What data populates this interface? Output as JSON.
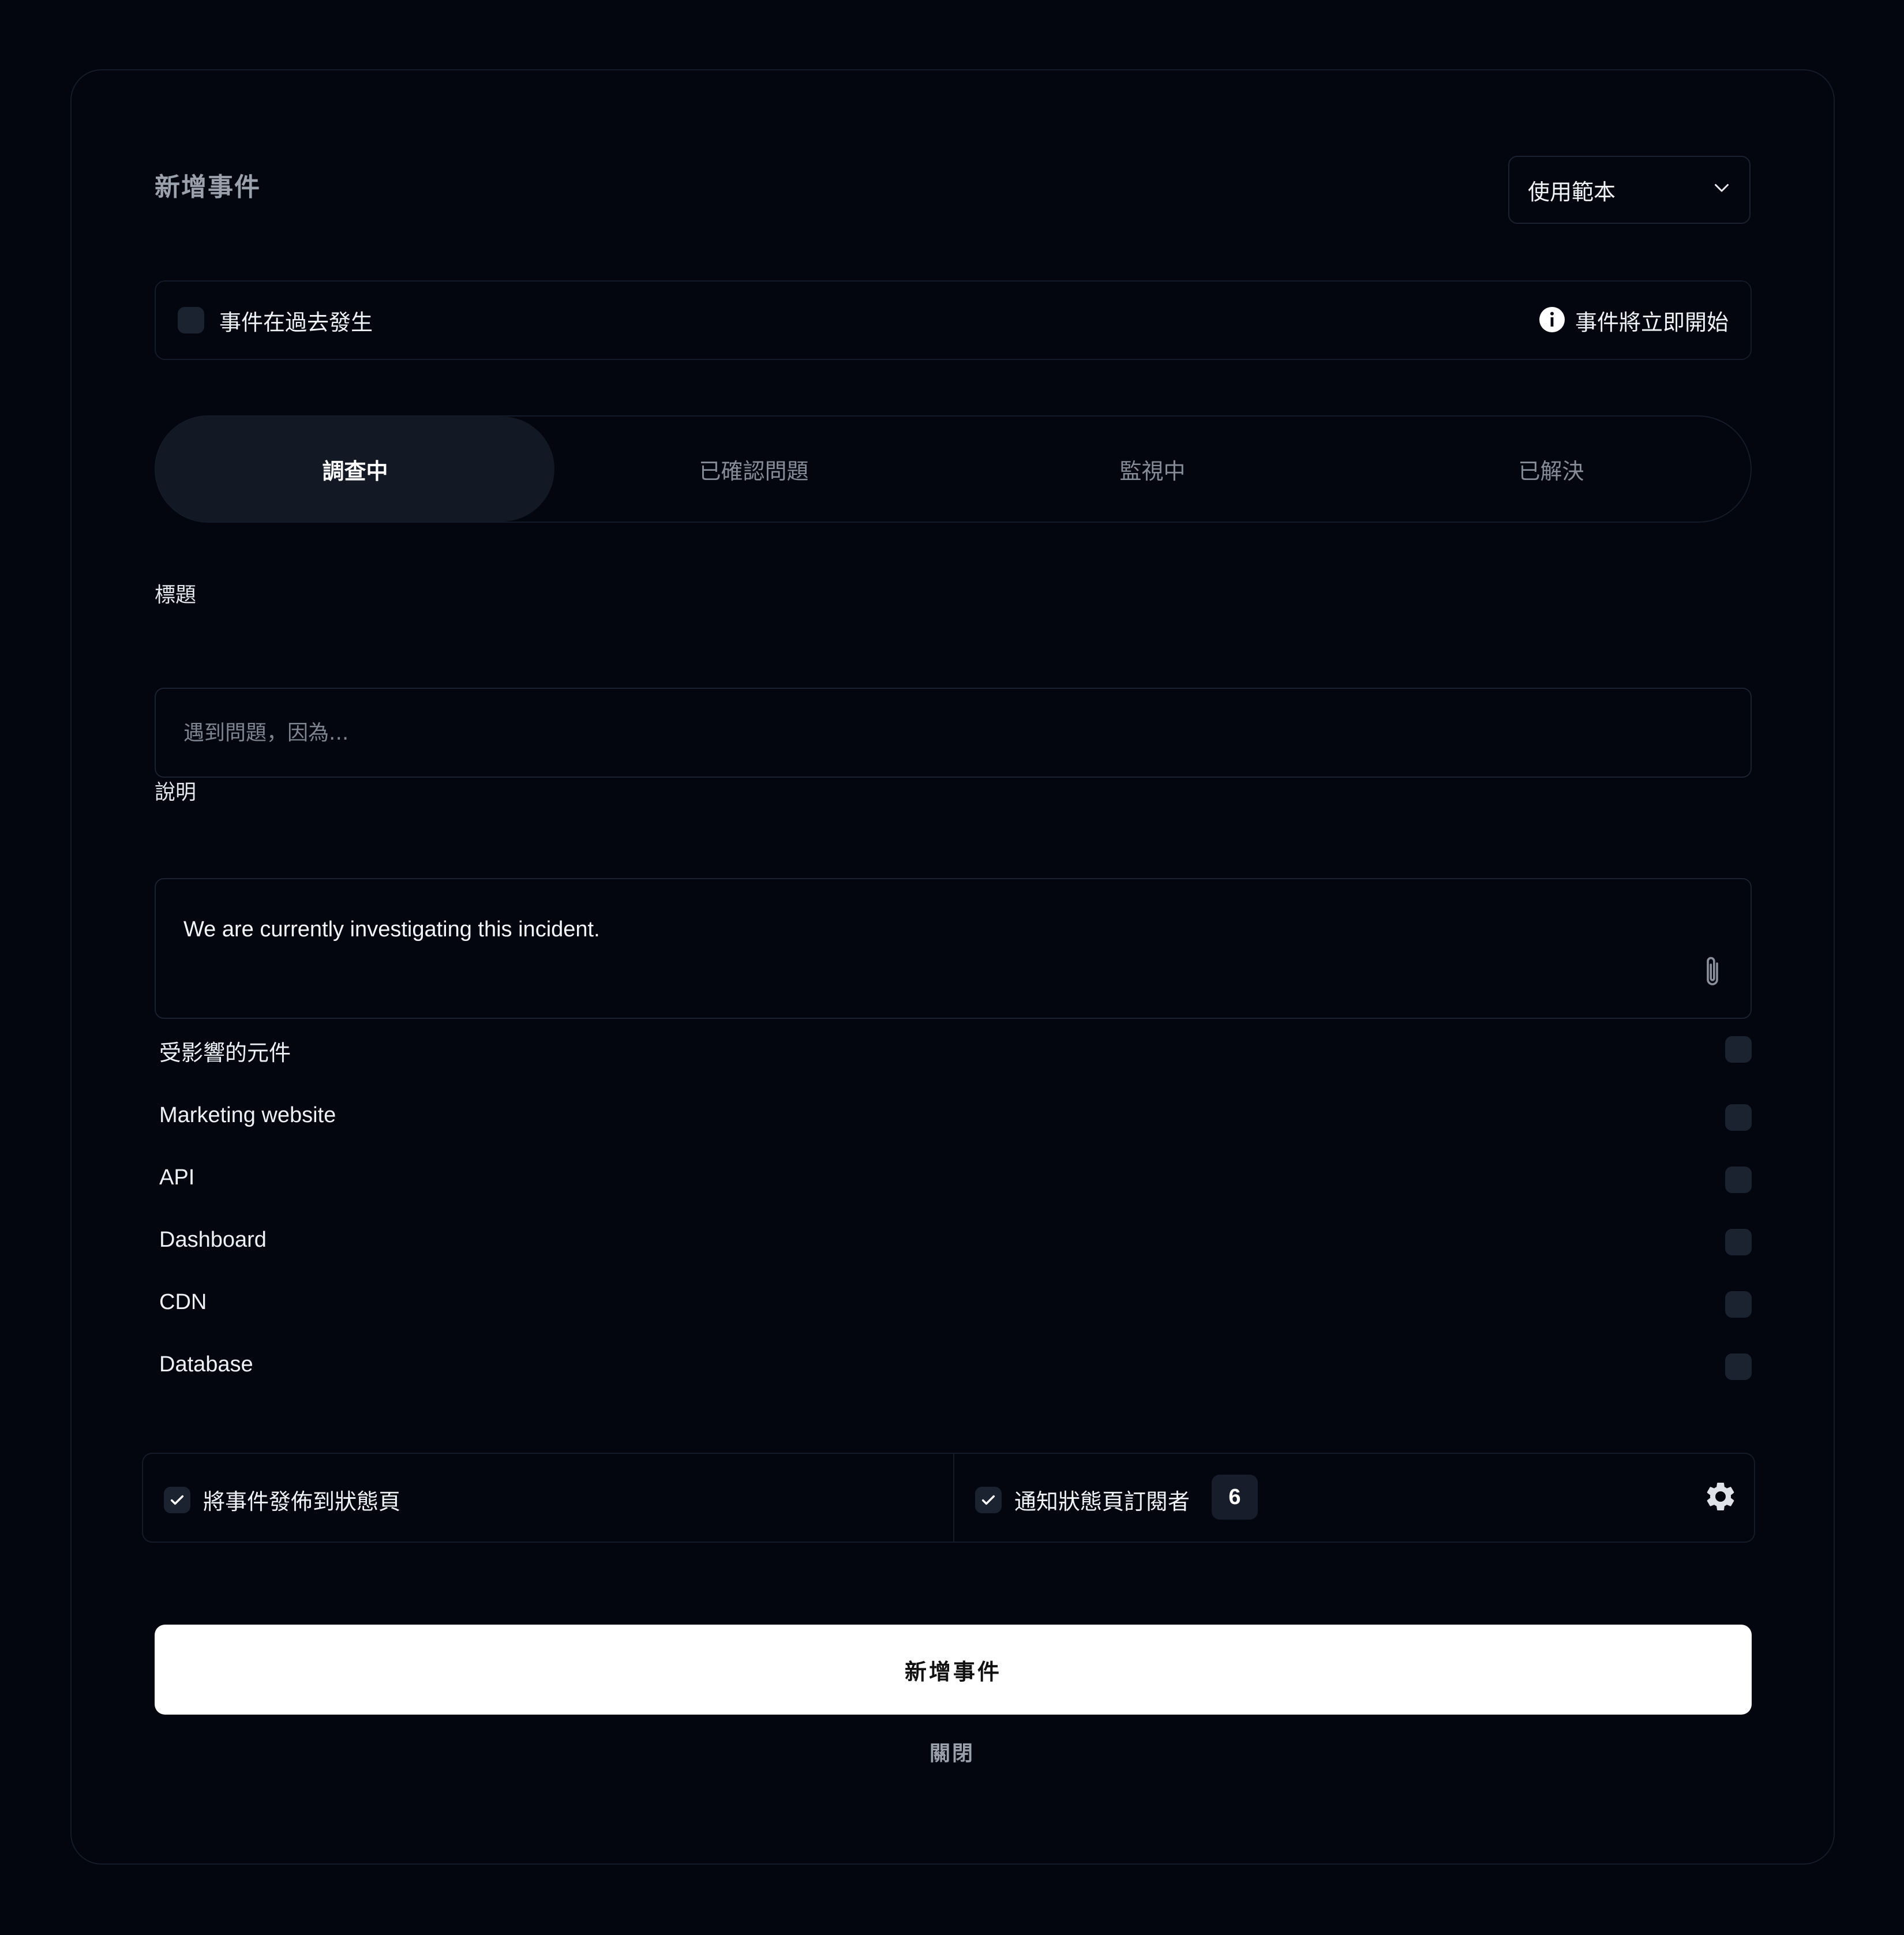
{
  "dialog": {
    "title": "新增事件",
    "template_select": {
      "value": "使用範本",
      "icon": "chevron-down-icon"
    }
  },
  "past_occurrence": {
    "label": "事件在過去發生",
    "info_icon": "info-icon",
    "info_text": "事件將立即開始"
  },
  "status_tabs": [
    {
      "label": "調查中",
      "active": true
    },
    {
      "label": "已確認問題",
      "active": false
    },
    {
      "label": "監視中",
      "active": false
    },
    {
      "label": "已解決",
      "active": false
    }
  ],
  "title_field": {
    "label": "標題",
    "placeholder": "遇到問題，因為...",
    "value": ""
  },
  "description_field": {
    "label": "說明",
    "value": "We are currently investigating this incident.",
    "attach_icon": "paperclip-icon"
  },
  "affected_components": {
    "header": "受影響的元件",
    "items": [
      {
        "label": "Marketing website"
      },
      {
        "label": "API"
      },
      {
        "label": "Dashboard"
      },
      {
        "label": "CDN"
      },
      {
        "label": "Database"
      }
    ]
  },
  "publish_options": {
    "publish_label": "將事件發佈到狀態頁",
    "publish_checked": true,
    "notify_label": "通知狀態頁訂閱者",
    "notify_checked": true,
    "subscriber_count": "6",
    "settings_icon": "gear-icon"
  },
  "actions": {
    "submit_label": "新增事件",
    "close_label": "關閉"
  }
}
